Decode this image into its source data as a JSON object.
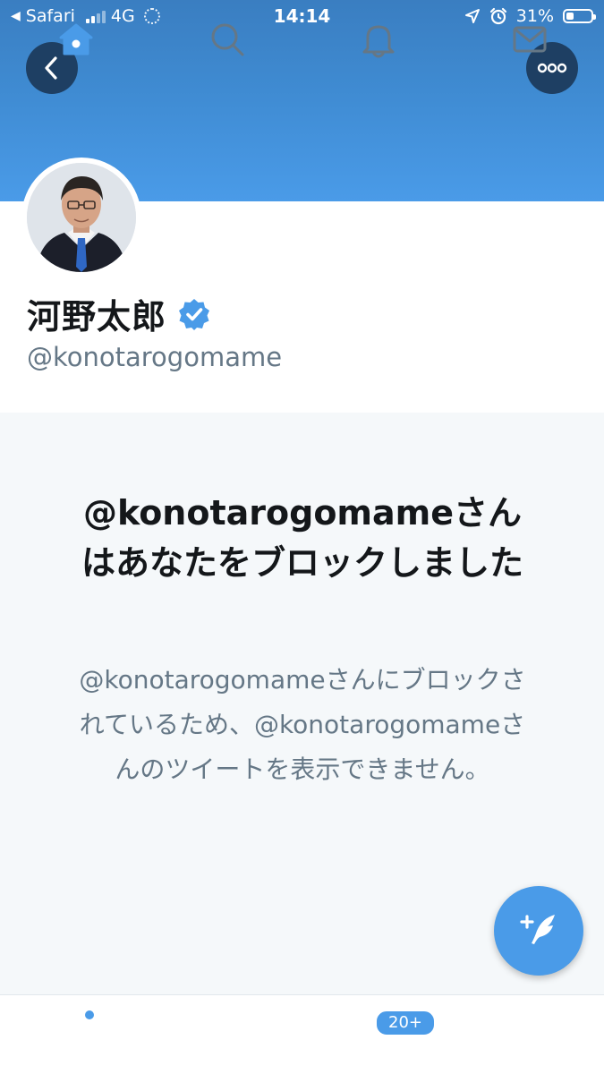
{
  "status_bar": {
    "back_app": "Safari",
    "network": "4G",
    "time": "14:14",
    "battery_percent": "31%",
    "battery_level": 0.31
  },
  "profile": {
    "name": "河野太郎",
    "handle": "@konotarogomame",
    "verified": true
  },
  "block_notice": {
    "title": "@konotarogomameさんはあなたをブロックしました",
    "description": "@konotarogomameさんにブロックされているため、@konotarogomameさんのツイートを表示できません。"
  },
  "tab_bar": {
    "notifications_badge": "20+"
  },
  "colors": {
    "accent": "#4a9be8",
    "banner_top": "#3a7ec1",
    "header_button": "#1e3f63",
    "text_primary": "#14171a",
    "text_secondary": "#657786",
    "tab_inactive": "#657786"
  },
  "icons": {
    "back": "chevron-left-icon",
    "more": "more-horizontal-icon",
    "verified": "verified-badge-icon",
    "compose": "compose-tweet-icon",
    "home": "home-icon",
    "search": "search-icon",
    "notifications": "bell-icon",
    "messages": "mail-icon"
  }
}
